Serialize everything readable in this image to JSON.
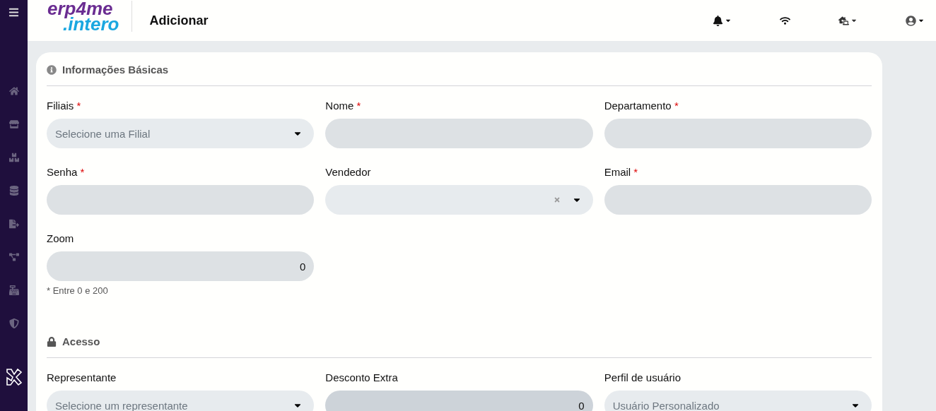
{
  "header": {
    "logo_top": "erp4me",
    "logo_bottom": ".intero",
    "title": "Adicionar"
  },
  "sections": [
    {
      "kind": "info",
      "title": "Informações Básicas",
      "fields": [
        {
          "label": "Filiais",
          "required_mark": "*",
          "kind": "select",
          "placeholder": "Selecione uma Filial",
          "disabled": false
        },
        {
          "label": "Nome",
          "required_mark": "*",
          "kind": "text",
          "disabled": false
        },
        {
          "label": "Departamento",
          "required_mark": "*",
          "kind": "text",
          "disabled": false
        },
        {
          "label": "Senha",
          "required_mark": "*",
          "kind": "text",
          "disabled": false
        },
        {
          "label": "Vendedor",
          "kind": "clearable",
          "disabled": false
        },
        {
          "label": "Email",
          "required_mark": "*",
          "kind": "text",
          "disabled": false
        },
        {
          "label": "Zoom",
          "kind": "number",
          "value": "0",
          "hint": "* Entre 0 e 200",
          "disabled": false
        }
      ]
    },
    {
      "kind": "lock",
      "title": "Acesso",
      "fields": [
        {
          "label": "Representante",
          "kind": "select",
          "placeholder": "Selecione um representante",
          "disabled": false
        },
        {
          "label": "Desconto Extra",
          "kind": "number",
          "value": "0",
          "disabled": true
        },
        {
          "label": "Perfil de usuário",
          "kind": "select",
          "placeholder": "Usuário Personalizado",
          "disabled": false
        }
      ]
    }
  ]
}
